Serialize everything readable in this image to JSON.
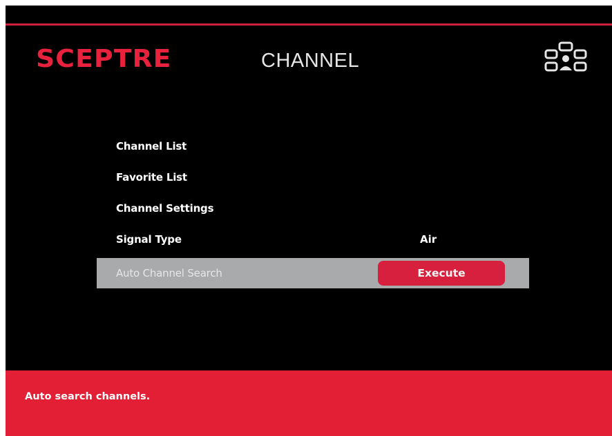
{
  "header": {
    "brand": "SCEPTRE",
    "title": "CHANNEL",
    "icon": "network-icon",
    "accent_color": "#e8213d"
  },
  "menu": {
    "items": [
      {
        "label": "Channel List",
        "value": ""
      },
      {
        "label": "Favorite List",
        "value": ""
      },
      {
        "label": "Channel Settings",
        "value": ""
      },
      {
        "label": "Signal Type",
        "value": "Air"
      },
      {
        "label": "Auto Channel Search",
        "button": "Execute",
        "selected": true
      }
    ]
  },
  "help": {
    "text": "Auto search channels."
  }
}
